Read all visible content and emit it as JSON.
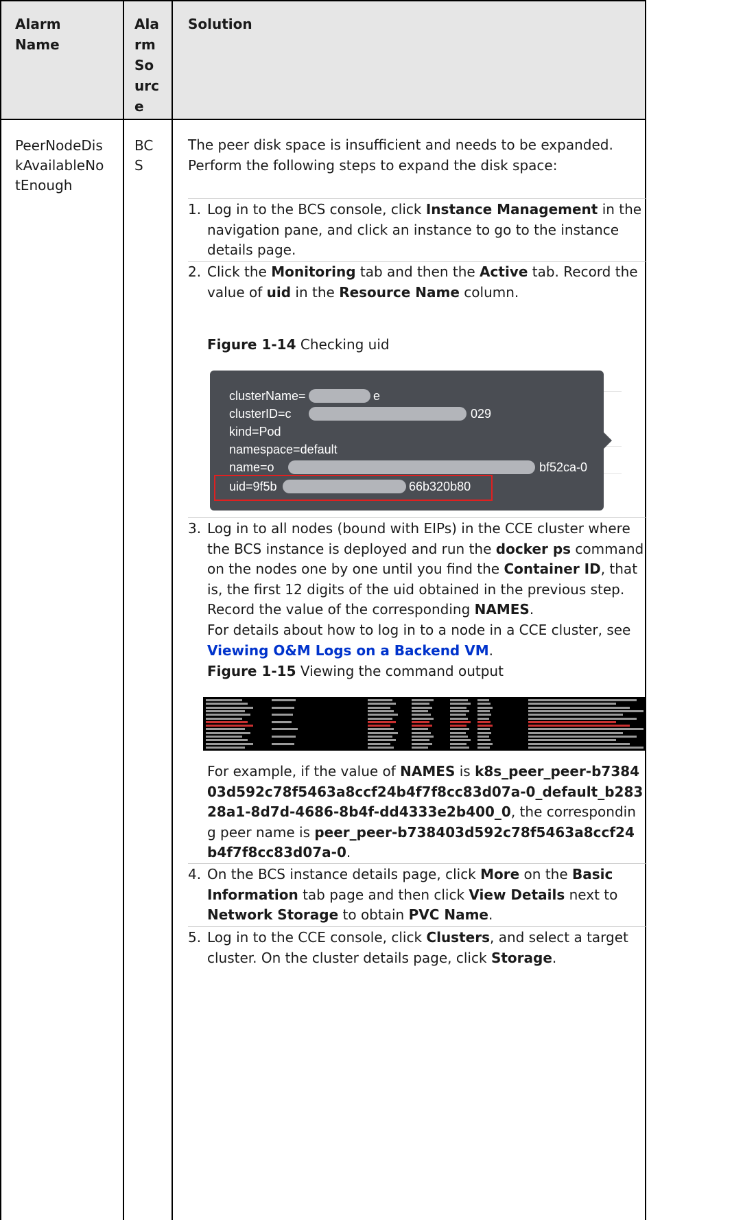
{
  "table": {
    "headers": [
      "Alarm Name",
      "Alarm Source",
      "Solution"
    ],
    "header_lines": {
      "alarm_name": [
        "Alarm",
        "Name"
      ],
      "alarm_source": [
        "Ala",
        "rm",
        "So",
        "urc",
        "e"
      ],
      "solution": [
        "Solution"
      ]
    },
    "row": {
      "alarm_name_lines": [
        "PeerNodeDis",
        "kAvailableNo",
        "tEnough"
      ],
      "alarm_source_lines": [
        "BC",
        "S"
      ],
      "intro": "The peer disk space is insufficient and needs to be expanded. Perform the following steps to expand the disk space:"
    }
  },
  "steps": [
    {
      "num": "1.",
      "html_parts": [
        "Log in to the BCS console, click ",
        "Instance Management",
        " in the navigation pane, and click an instance to go to the instance details page."
      ]
    },
    {
      "num": "2.",
      "html_parts": [
        "Click the ",
        "Monitoring",
        " tab and then the ",
        "Active",
        " tab. Record the value of ",
        "uid",
        " in the ",
        "Resource Name",
        " column."
      ]
    },
    {
      "num": "3.",
      "html_parts": [
        "Log in to all nodes (bound with EIPs) in the CCE cluster where the BCS instance is deployed and run the ",
        "docker ps",
        " command on the nodes one by one until you find the ",
        "Container ID",
        ", that is, the first 12 digits of the uid obtained in the previous step. Record the value of the corresponding ",
        "NAMES",
        "."
      ]
    },
    {
      "num": "4.",
      "html_parts": [
        "On the BCS instance details page, click ",
        "More",
        " on the ",
        "Basic Information",
        " tab page and then click ",
        "View Details",
        " next to ",
        "Network Storage",
        " to obtain ",
        "PVC Name",
        "."
      ]
    },
    {
      "num": "5.",
      "html_parts": [
        "Log in to the CCE console, click ",
        "Clusters",
        ", and select a target cluster. On the cluster details page, click ",
        "Storage",
        "."
      ]
    }
  ],
  "step3_extra": {
    "text": "For details about how to log in to a node in a CCE cluster, see ",
    "link": "Viewing O&M Logs on a Backend VM",
    "end": "."
  },
  "figure14": {
    "label": "Figure 1-14",
    "caption": " Checking uid",
    "lines": [
      "clusterName=",
      "clusterID=c",
      "kind=Pod",
      "namespace=default",
      "name=o",
      "uid=9f5b"
    ],
    "line_tails": [
      "e",
      "029",
      "",
      "",
      "bf52ca-0",
      "66b320b80"
    ]
  },
  "figure15": {
    "label": "Figure 1-15",
    "caption": " Viewing the command output"
  },
  "example": {
    "parts": [
      "For example, if the value of ",
      "NAMES",
      " is ",
      "k8s_peer_peer-b738403d592c78f5463a8ccf24b4f7f8cc83d07a-0_default_b28328a1-8d7d-4686-8b4f-dd4333e2b400_0",
      ", the corresponding peer name is ",
      "peer_peer-b738403d592c78f5463a8ccf24b4f7f8cc83d07a-0",
      "."
    ]
  },
  "colors": {
    "header_bg": "#e6e6e6",
    "link": "#0033cc",
    "highlight_box": "#e02020",
    "tooltip_bg": "#4a4d53"
  }
}
